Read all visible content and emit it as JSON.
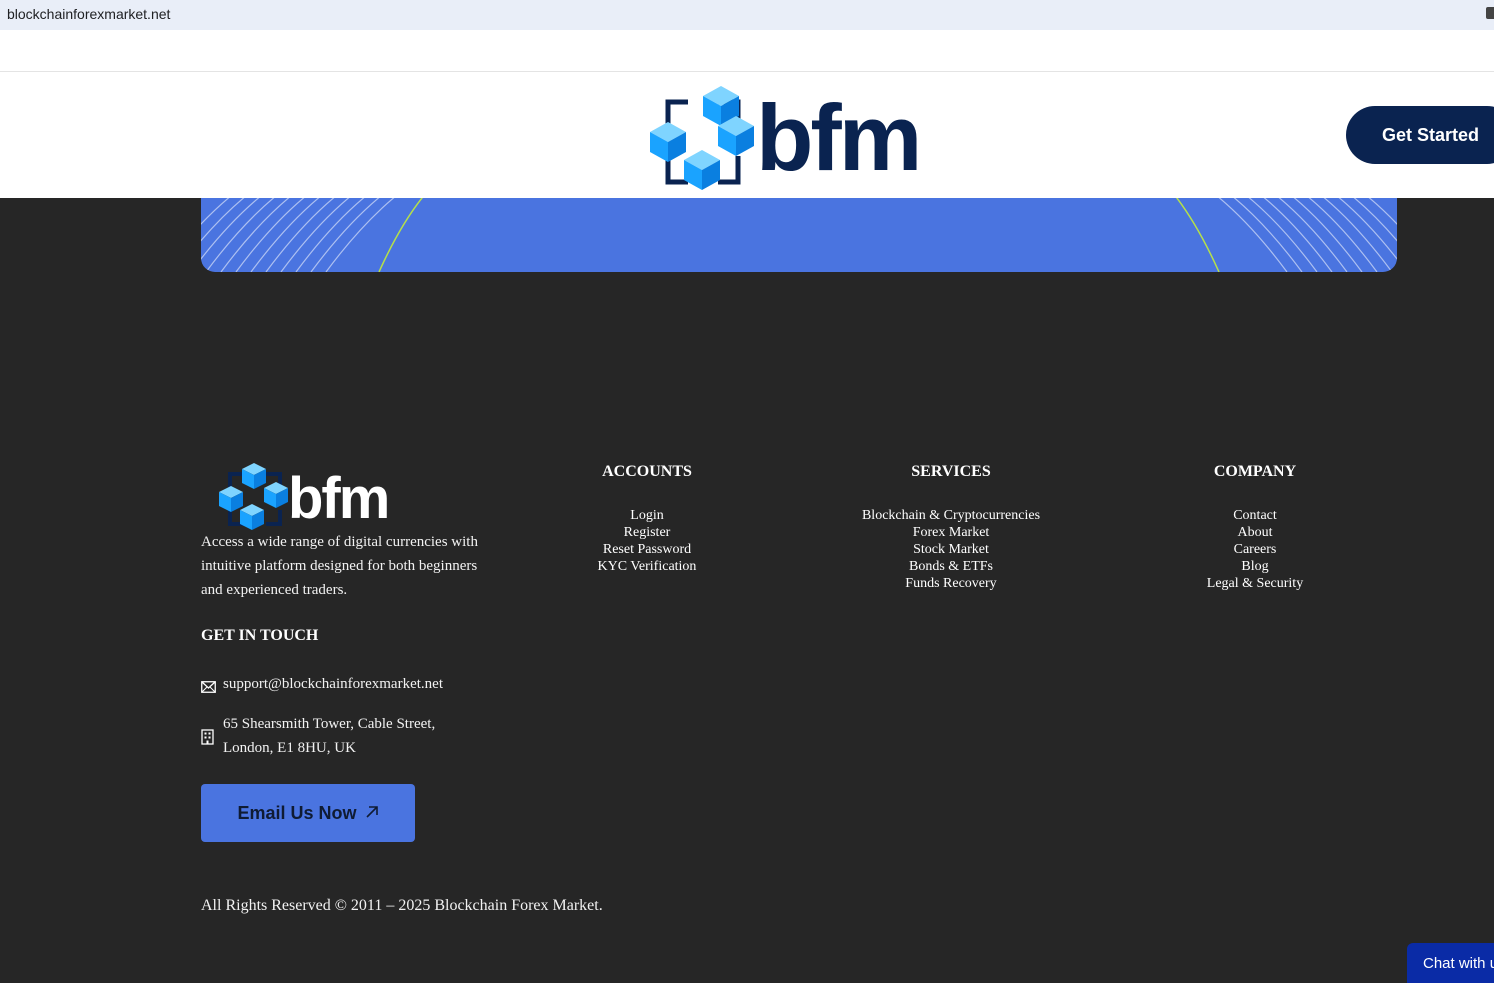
{
  "browser": {
    "url": "blockchainforexmarket.net"
  },
  "header": {
    "logo_text": "bfm",
    "cta_label": "Get Started"
  },
  "footer": {
    "logo_text": "bfm",
    "about": "Access a wide range of digital currencies with intuitive platform designed for both beginners and experienced traders.",
    "get_in_touch": "GET IN TOUCH",
    "email": "support@blockchainforexmarket.net",
    "address_line1": "65 Shearsmith Tower, Cable Street,",
    "address_line2": "London, E1 8HU, UK",
    "email_button": "Email Us Now",
    "columns": [
      {
        "title": "ACCOUNTS",
        "items": [
          "Login",
          "Register",
          "Reset Password",
          "KYC Verification"
        ]
      },
      {
        "title": "SERVICES",
        "items": [
          "Blockchain & Cryptocurrencies",
          "Forex Market",
          "Stock Market",
          "Bonds & ETFs",
          "Funds Recovery"
        ]
      },
      {
        "title": "COMPANY",
        "items": [
          "Contact",
          "About",
          "Careers",
          "Blog",
          "Legal & Security"
        ]
      }
    ],
    "copyright": "All Rights Reserved © 2011 – 2025 Blockchain Forex Market."
  },
  "chat": {
    "label": "Chat with us"
  },
  "colors": {
    "brand_navy": "#0a2350",
    "accent_blue": "#4a74e0",
    "footer_bg": "#262626",
    "cube_blue": "#1aa3ff"
  },
  "icons": [
    "envelope-icon",
    "building-icon",
    "arrow-up-right-icon"
  ]
}
